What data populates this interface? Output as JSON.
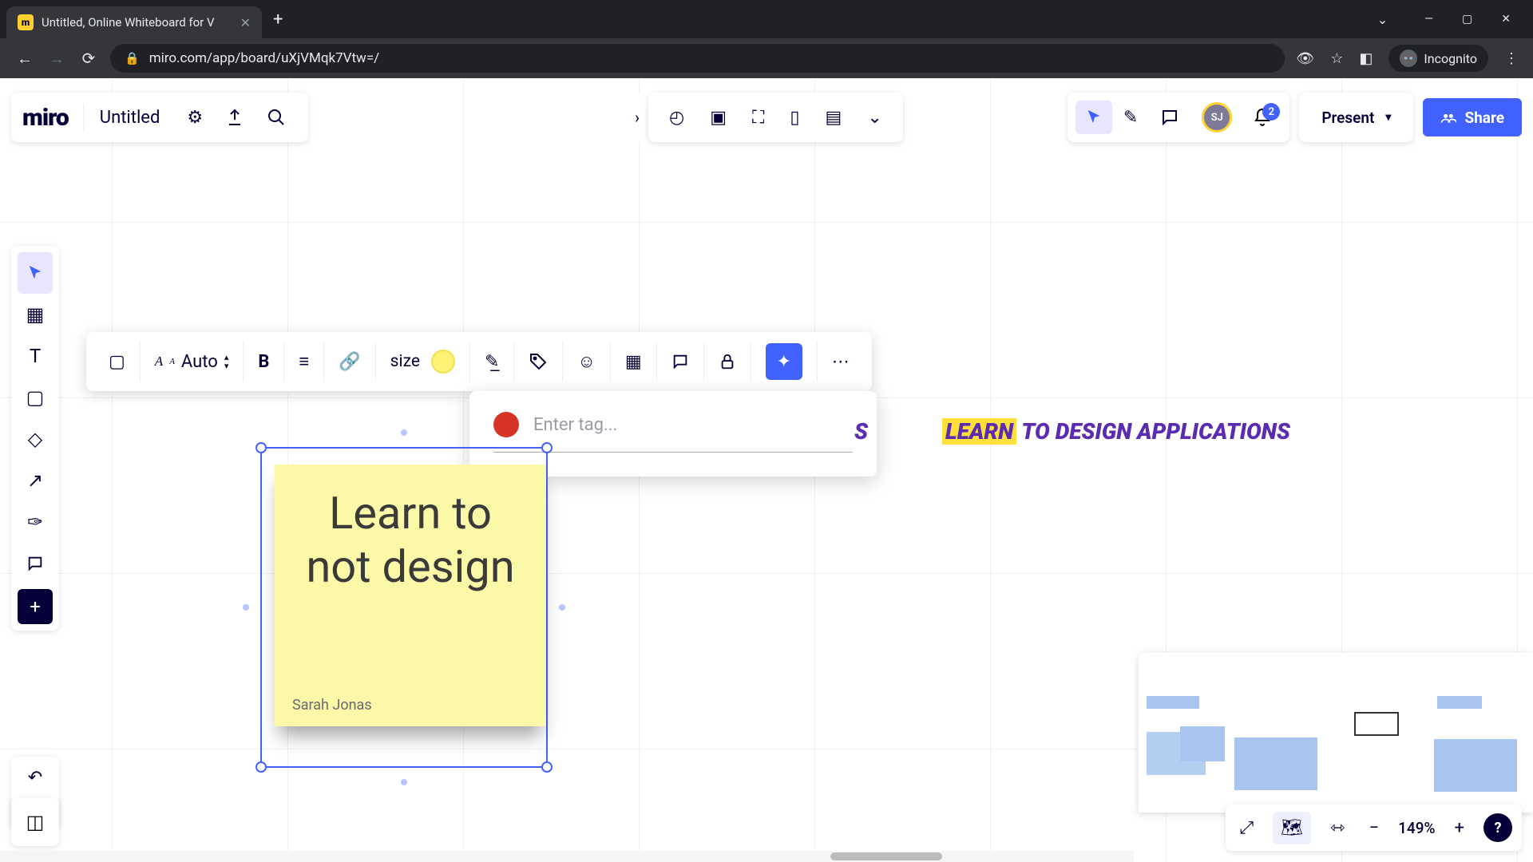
{
  "browser": {
    "tab_title": "Untitled, Online Whiteboard for V",
    "url": "miro.com/app/board/uXjVMqk7Vtw=/",
    "incognito_label": "Incognito"
  },
  "header": {
    "logo": "miro",
    "board_title": "Untitled",
    "present_label": "Present",
    "share_label": "Share",
    "notification_count": "2",
    "avatar_initials": "SJ"
  },
  "context_toolbar": {
    "auto_label": "Auto",
    "size_label": "size"
  },
  "tag_popup": {
    "placeholder": "Enter tag...",
    "color": "#d63427"
  },
  "sticky": {
    "text": "Learn to not design",
    "author": "Sarah Jonas",
    "color": "#fbf8a8"
  },
  "canvas_text": {
    "fragment_a": "S",
    "b_highlight": "LEARN",
    "b_rest": " TO DESIGN APPLICATIONS"
  },
  "zoom": {
    "level": "149%"
  }
}
